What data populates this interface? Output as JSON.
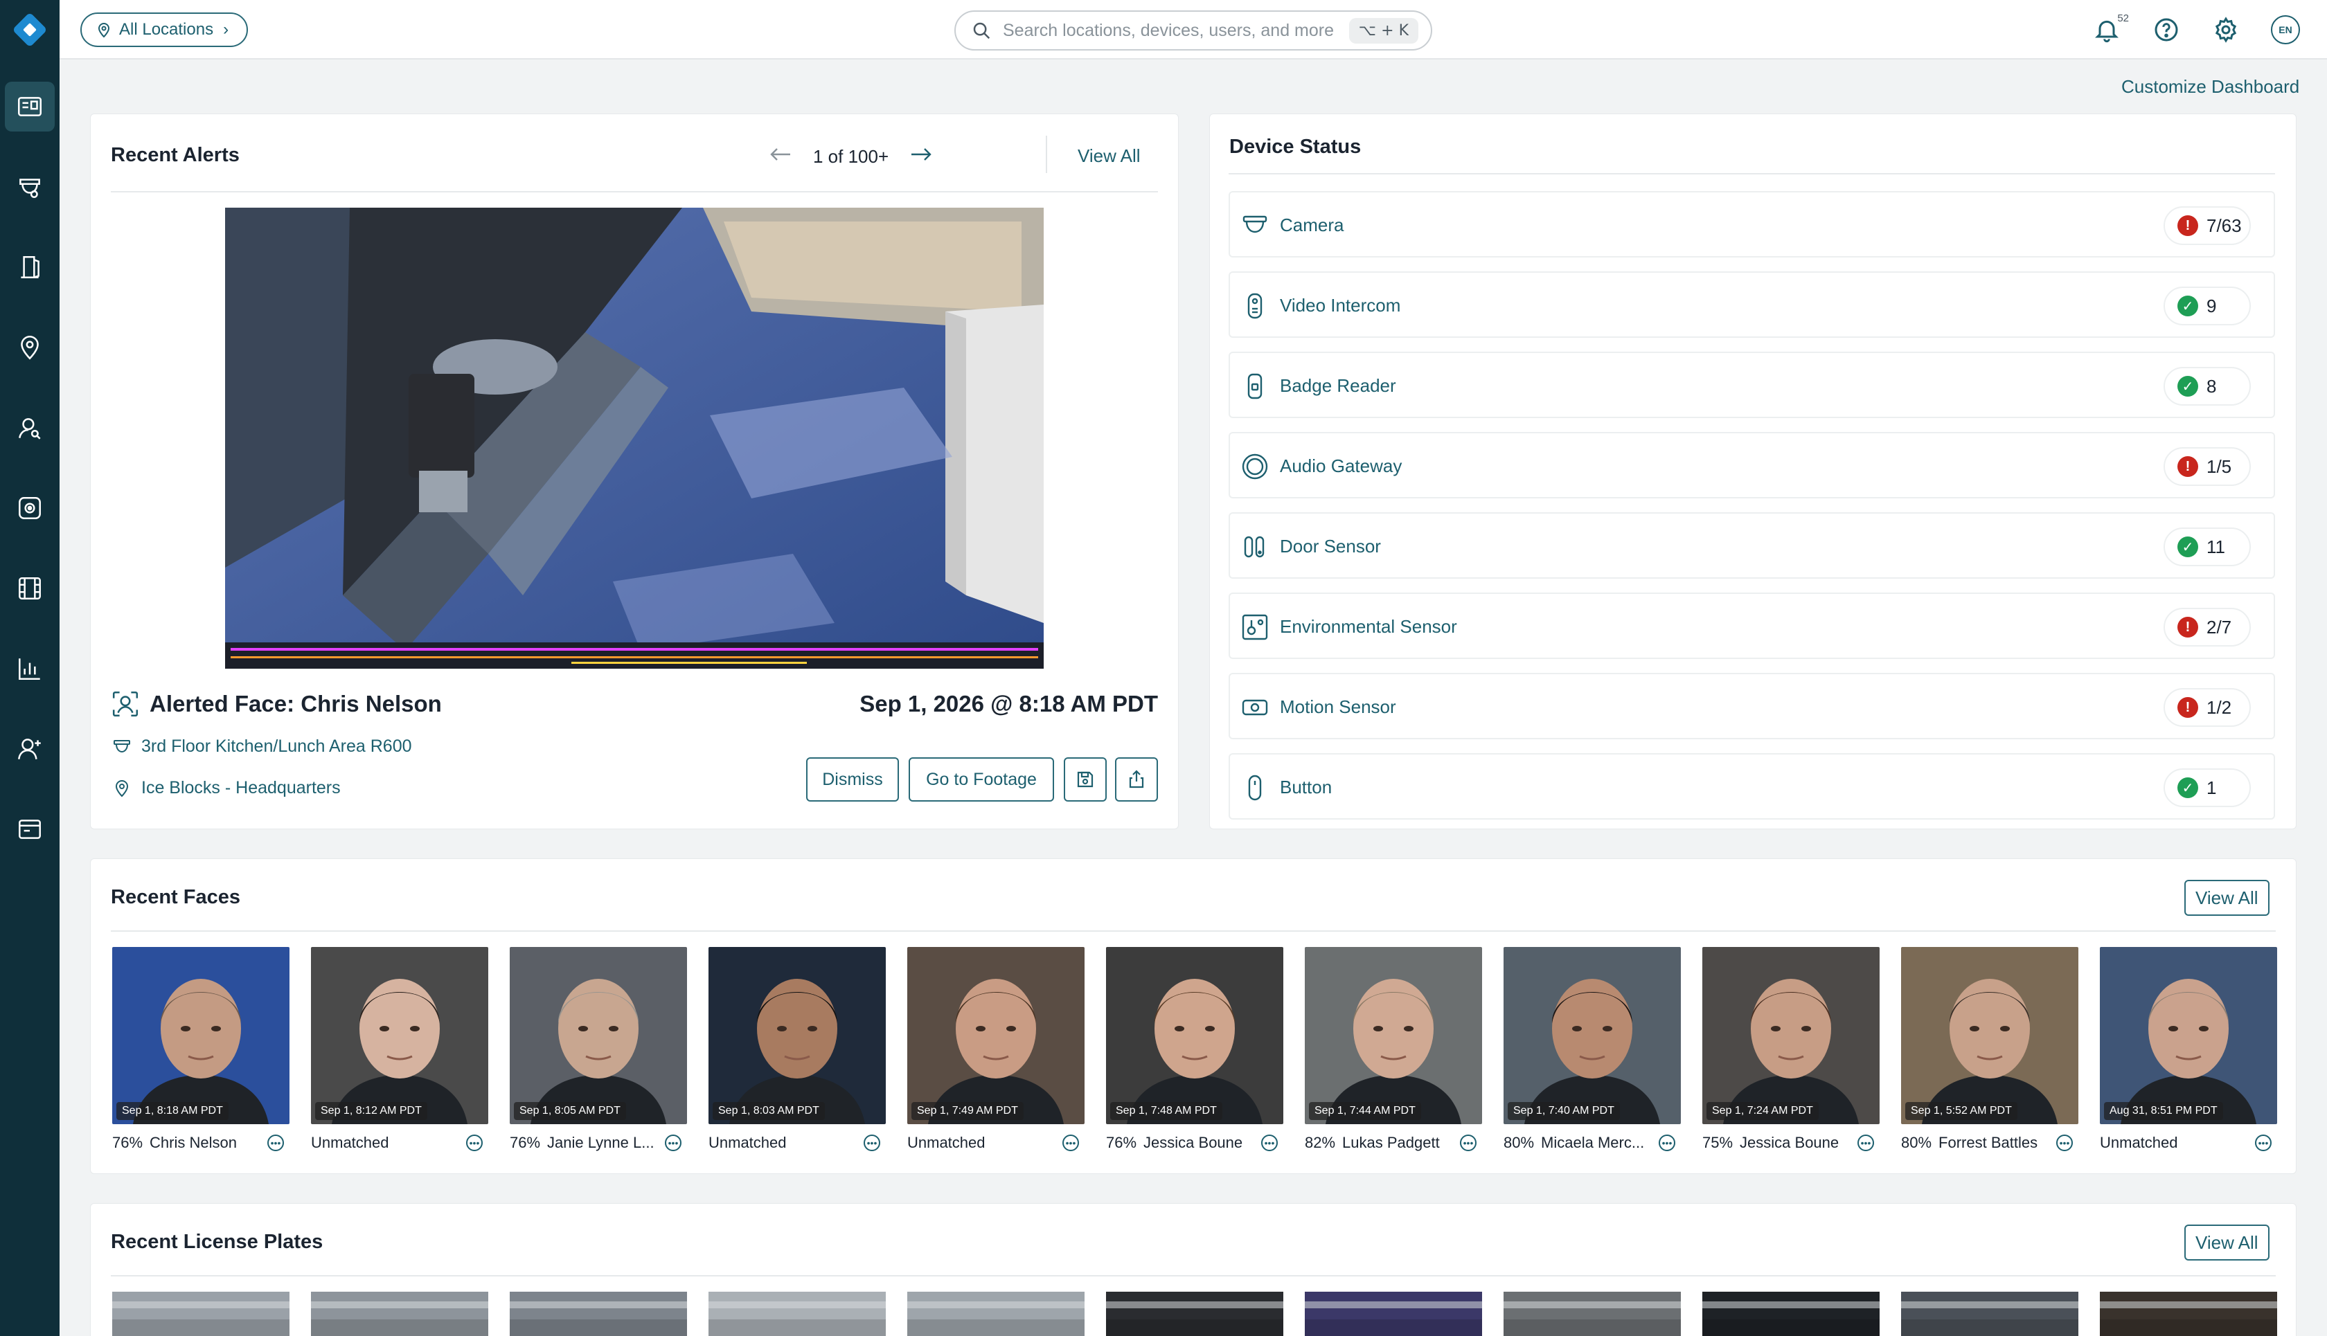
{
  "topbar": {
    "location_pill": "All Locations",
    "search_placeholder": "Search locations, devices, users, and more",
    "search_shortcut": "⌥ + K",
    "notification_count": "52",
    "language": "EN"
  },
  "dashboard": {
    "customize_label": "Customize Dashboard"
  },
  "recent_alerts": {
    "title": "Recent Alerts",
    "pager": "1 of 100+",
    "view_all": "View All",
    "face_title": "Alerted Face: Chris Nelson",
    "date": "Sep 1, 2026 @ 8:18 AM PDT",
    "camera": "3rd Floor Kitchen/Lunch Area R600",
    "site": "Ice Blocks - Headquarters",
    "dismiss_label": "Dismiss",
    "footage_label": "Go to Footage"
  },
  "device_status": {
    "title": "Device Status",
    "devices": [
      {
        "label": "Camera",
        "count": "7/63",
        "status": "error"
      },
      {
        "label": "Video Intercom",
        "count": "9",
        "status": "ok"
      },
      {
        "label": "Badge Reader",
        "count": "8",
        "status": "ok"
      },
      {
        "label": "Audio Gateway",
        "count": "1/5",
        "status": "error"
      },
      {
        "label": "Door Sensor",
        "count": "11",
        "status": "ok"
      },
      {
        "label": "Environmental Sensor",
        "count": "2/7",
        "status": "error"
      },
      {
        "label": "Motion Sensor",
        "count": "1/2",
        "status": "error"
      },
      {
        "label": "Button",
        "count": "1",
        "status": "ok"
      }
    ]
  },
  "recent_faces": {
    "title": "Recent Faces",
    "view_all": "View All",
    "faces": [
      {
        "timestamp": "Sep 1, 8:18 AM PDT",
        "pct": "76%",
        "name": "Chris Nelson"
      },
      {
        "timestamp": "Sep 1, 8:12 AM PDT",
        "pct": "",
        "name": "Unmatched"
      },
      {
        "timestamp": "Sep 1, 8:05 AM PDT",
        "pct": "76%",
        "name": "Janie Lynne L..."
      },
      {
        "timestamp": "Sep 1, 8:03 AM PDT",
        "pct": "",
        "name": "Unmatched"
      },
      {
        "timestamp": "Sep 1, 7:49 AM PDT",
        "pct": "",
        "name": "Unmatched"
      },
      {
        "timestamp": "Sep 1, 7:48 AM PDT",
        "pct": "76%",
        "name": "Jessica Boune"
      },
      {
        "timestamp": "Sep 1, 7:44 AM PDT",
        "pct": "82%",
        "name": "Lukas Padgett"
      },
      {
        "timestamp": "Sep 1, 7:40 AM PDT",
        "pct": "80%",
        "name": "Micaela Merc..."
      },
      {
        "timestamp": "Sep 1, 7:24 AM PDT",
        "pct": "75%",
        "name": "Jessica Boune"
      },
      {
        "timestamp": "Sep 1, 5:52 AM PDT",
        "pct": "80%",
        "name": "Forrest Battles"
      },
      {
        "timestamp": "Aug 31, 8:51 PM PDT",
        "pct": "",
        "name": "Unmatched"
      }
    ]
  },
  "recent_plates": {
    "title": "Recent License Plates",
    "view_all": "View All"
  },
  "colors": {
    "sidebar_bg": "#0f2f3a",
    "accent": "#1d5f6e",
    "error": "#c8261d",
    "ok": "#1e9e55"
  }
}
